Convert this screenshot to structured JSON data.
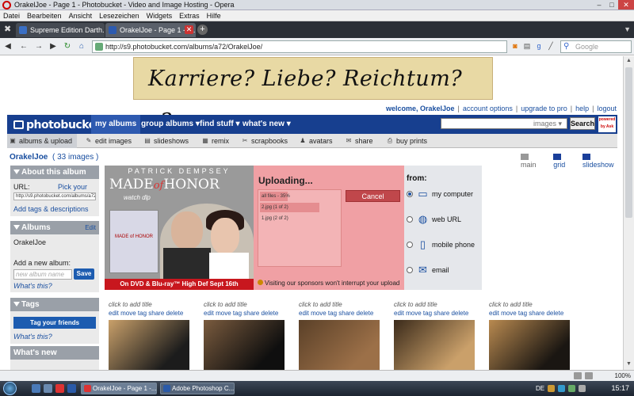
{
  "window": {
    "title": "OrakelJoe - Page 1 - Photobucket - Video and Image Hosting - Opera"
  },
  "menu": [
    "Datei",
    "Bearbeiten",
    "Ansicht",
    "Lesezeichen",
    "Widgets",
    "Extras",
    "Hilfe"
  ],
  "tabs": [
    {
      "label": "Supreme Edition Darth...",
      "active": false
    },
    {
      "label": "OrakelJoe - Page 1 - P...",
      "active": true
    }
  ],
  "address": {
    "url": "http://s9.photobucket.com/albums/a72/OrakelJoe/",
    "search_placeholder": "Google"
  },
  "banner": {
    "text": "Karriere? Liebe? Reichtum? ¿?"
  },
  "toplinks": {
    "welcome": "welcome, OrakelJoe",
    "items": [
      "account options",
      "upgrade to pro",
      "help",
      "logout"
    ]
  },
  "pbnav": {
    "logo": "photobucket",
    "tabs": [
      "my albums",
      "group albums ▾",
      "find stuff ▾",
      "what's new ▾"
    ],
    "search_scope": "images ▾",
    "search_button": "Search",
    "powered": "powered by Ask"
  },
  "subnav": [
    "albums & upload",
    "edit images",
    "slideshows",
    "remix",
    "scrapbooks",
    "avatars",
    "share",
    "buy prints"
  ],
  "album": {
    "name": "OrakelJoe",
    "count": "( 33 images )"
  },
  "views": [
    "main",
    "grid",
    "slideshow"
  ],
  "sidebar": {
    "about": {
      "title": "About this album",
      "url_label": "URL:",
      "pick_link": "Pick your own",
      "url_value": "http://s9.photobucket.com/albums/a72/OrakelJoe/",
      "tags_link": "Add tags & descriptions"
    },
    "albums": {
      "title": "Albums",
      "edit": "Edit",
      "user": "OrakelJoe",
      "add_label": "Add a new album:",
      "placeholder": "new album name",
      "save": "Save",
      "whats_this": "What's this?"
    },
    "tags": {
      "title": "Tags",
      "button": "Tag your friends",
      "whats_this": "What's this?"
    },
    "whatsnew": {
      "title": "What's new"
    }
  },
  "ad": {
    "actor": "PATRICK DEMPSEY",
    "title_a": "MADE",
    "title_of": "of",
    "title_b": "HONOR",
    "subtitle": "watch dlp",
    "dvd": "MADE of HONOR",
    "strip": "On DVD & Blu-ray™ High Def Sept 16th"
  },
  "upload": {
    "title": "Uploading...",
    "rows": [
      {
        "label": "all files - 35%",
        "progress": 0.35
      },
      {
        "label": "2.jpg (1 of 2)",
        "progress": 0.75
      },
      {
        "label": "1.jpg (2 of 2)",
        "progress": 0
      }
    ],
    "cancel": "Cancel",
    "sponsor": "Visiting our sponsors won't interrupt your upload"
  },
  "from": {
    "title": "from:",
    "sources": [
      {
        "label": "my computer",
        "icon": "monitor-icon",
        "selected": true
      },
      {
        "label": "web URL",
        "icon": "globe-icon",
        "selected": false
      },
      {
        "label": "mobile phone",
        "icon": "phone-icon",
        "selected": false
      },
      {
        "label": "email",
        "icon": "envelope-icon",
        "selected": false
      }
    ]
  },
  "thumbnails": {
    "caption": "click to add title",
    "actions": "edit  move  tag  share  delete",
    "items": [
      {
        "color_a": "#c9a06a",
        "color_b": "#1c1c1c"
      },
      {
        "color_a": "#7a5b3e",
        "color_b": "#0f0f0f"
      },
      {
        "color_a": "#5a4028",
        "color_b": "#9c7048"
      },
      {
        "color_a": "#3a2a1a",
        "color_b": "#caa06a"
      },
      {
        "color_a": "#b98a50",
        "color_b": "#1a1612"
      }
    ]
  },
  "status": {
    "zoom": "100%"
  },
  "taskbar": {
    "tasks": [
      "OrakelJoe - Page 1 -...",
      "Adobe Photoshop C..."
    ],
    "lang": "DE",
    "clock": "15:17"
  },
  "colors": {
    "pb_blue": "#173f8f",
    "upload_pink": "#f0a0a4",
    "link": "#1a4fa0",
    "ad_red": "#c8171e"
  }
}
